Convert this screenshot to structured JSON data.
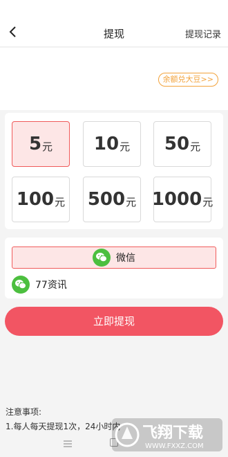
{
  "header": {
    "title": "提现",
    "records_label": "提现记录"
  },
  "balance": {
    "exchange_label": "余额兑大豆>>"
  },
  "amounts": [
    {
      "value": "5",
      "unit": "元",
      "selected": true
    },
    {
      "value": "10",
      "unit": "元",
      "selected": false
    },
    {
      "value": "50",
      "unit": "元",
      "selected": false
    },
    {
      "value": "100",
      "unit": "元",
      "selected": false
    },
    {
      "value": "500",
      "unit": "元",
      "selected": false
    },
    {
      "value": "1000",
      "unit": "元",
      "selected": false
    }
  ],
  "payment": {
    "method_label": "微信",
    "account_name": "77资讯"
  },
  "submit_label": "立即提现",
  "notes": {
    "title": "注意事项:",
    "line1": "1.每人每天提现1次，24小时内"
  },
  "watermark": {
    "text": "飞翔下载",
    "url": "WWW.FXXZ.COM"
  },
  "colors": {
    "accent": "#f25563",
    "selected_bg": "#fde6e6",
    "wechat_green": "#4cbf3f",
    "exchange_orange": "#f2a23a"
  }
}
